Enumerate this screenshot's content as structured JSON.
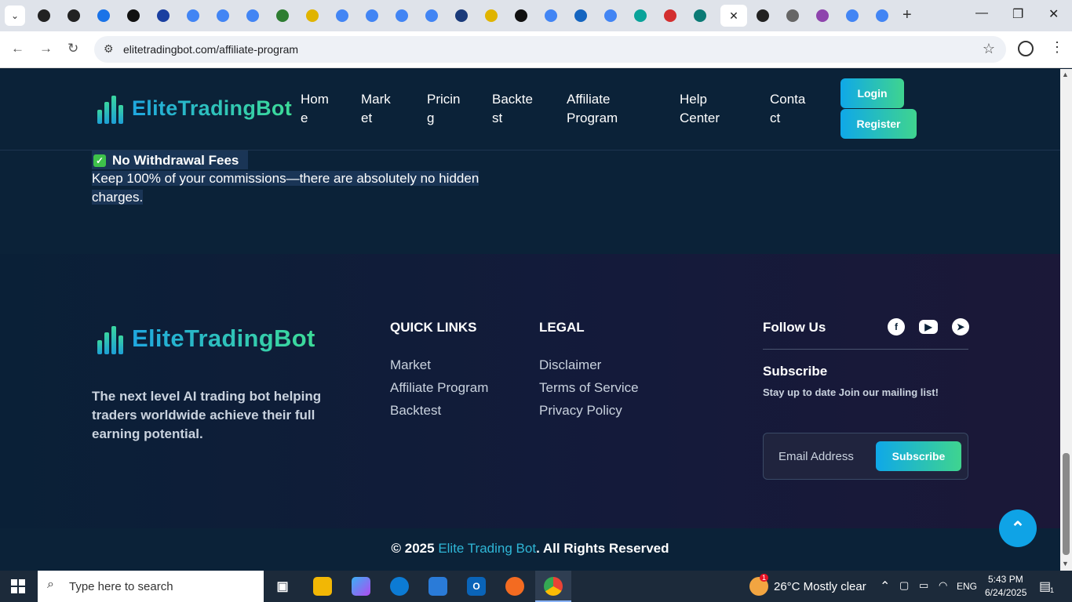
{
  "browser": {
    "tabs": [
      {
        "icon": "threads-icon",
        "color": "#222"
      },
      {
        "icon": "threads-icon",
        "color": "#222"
      },
      {
        "icon": "loading-spinner-icon",
        "color": "#1a73e8"
      },
      {
        "icon": "w-logo-icon",
        "color": "#111"
      },
      {
        "icon": "ttp-icon",
        "color": "#1a3fa0"
      },
      {
        "icon": "google-icon",
        "color": "#4285f4"
      },
      {
        "icon": "google-icon",
        "color": "#4285f4"
      },
      {
        "icon": "google-icon",
        "color": "#4285f4"
      },
      {
        "icon": "globe-green-icon",
        "color": "#2e7d32"
      },
      {
        "icon": "yellow-logo-icon",
        "color": "#e0b400"
      },
      {
        "icon": "google-icon",
        "color": "#4285f4"
      },
      {
        "icon": "google-icon",
        "color": "#4285f4"
      },
      {
        "icon": "google-icon",
        "color": "#4285f4"
      },
      {
        "icon": "google-icon",
        "color": "#4285f4"
      },
      {
        "icon": "blue-square-icon",
        "color": "#1a3a7a"
      },
      {
        "icon": "yellow-logo-icon",
        "color": "#e0b400"
      },
      {
        "icon": "fn-icon",
        "color": "#111"
      },
      {
        "icon": "google-icon",
        "color": "#4285f4"
      },
      {
        "icon": "xf-icon",
        "color": "#1565c0"
      },
      {
        "icon": "google-icon",
        "color": "#4285f4"
      },
      {
        "icon": "teal-bird-icon",
        "color": "#0aa39a"
      },
      {
        "icon": "red-logo-icon",
        "color": "#d32f2f"
      },
      {
        "icon": "triangle-logo-icon",
        "color": "#0b7a75"
      }
    ],
    "tabs_after": [
      {
        "icon": "dark-square-icon",
        "color": "#222"
      },
      {
        "icon": "globe-gray-icon",
        "color": "#666"
      },
      {
        "icon": "purple-bell-icon",
        "color": "#8e44ad"
      },
      {
        "icon": "google-icon",
        "color": "#4285f4"
      },
      {
        "icon": "google-icon",
        "color": "#4285f4"
      }
    ],
    "url": "elitetradingbot.com/affiliate-program"
  },
  "site": {
    "logo_text": "EliteTradingBot",
    "nav": [
      {
        "line1": "Hom",
        "line2": "e"
      },
      {
        "line1": "Mark",
        "line2": "et"
      },
      {
        "line1": "Pricin",
        "line2": "g"
      },
      {
        "line1": "Backte",
        "line2": "st"
      },
      {
        "line1": "Affiliate",
        "line2": "Program"
      },
      {
        "line1": "Help",
        "line2": "Center"
      },
      {
        "line1": "Conta",
        "line2": "ct"
      }
    ],
    "login_label": "Login",
    "register_label": "Register",
    "accent_colors": [
      "#0fa8e8",
      "#3fd48f"
    ]
  },
  "feature": {
    "title": "No Withdrawal Fees",
    "desc_line1": "Keep 100% of your commissions—there are absolutely no hidden",
    "desc_line2": "charges."
  },
  "footer": {
    "logo_text": "EliteTradingBot",
    "description": "The next level AI trading bot helping traders worldwide achieve their full earning potential.",
    "quick_links_heading": "QUICK LINKS",
    "quick_links": [
      "Market",
      "Affiliate Program",
      "Backtest"
    ],
    "legal_heading": "LEGAL",
    "legal_links": [
      "Disclaimer",
      "Terms of Service",
      "Privacy Policy"
    ],
    "follow_heading": "Follow Us",
    "subscribe_heading": "Subscribe",
    "subscribe_text": "Stay up to date Join our mailing list!",
    "email_placeholder": "Email Address",
    "subscribe_button": "Subscribe",
    "copyright_prefix": "© 2025 ",
    "copyright_brand": "Elite Trading Bot",
    "copyright_suffix": ". All Rights Reserved"
  },
  "taskbar": {
    "search_placeholder": "Type here to search",
    "weather": "26°C  Mostly clear",
    "weather_badge": "1",
    "language": "ENG",
    "time": "5:43 PM",
    "date": "6/24/2025",
    "notification_count": "1"
  }
}
